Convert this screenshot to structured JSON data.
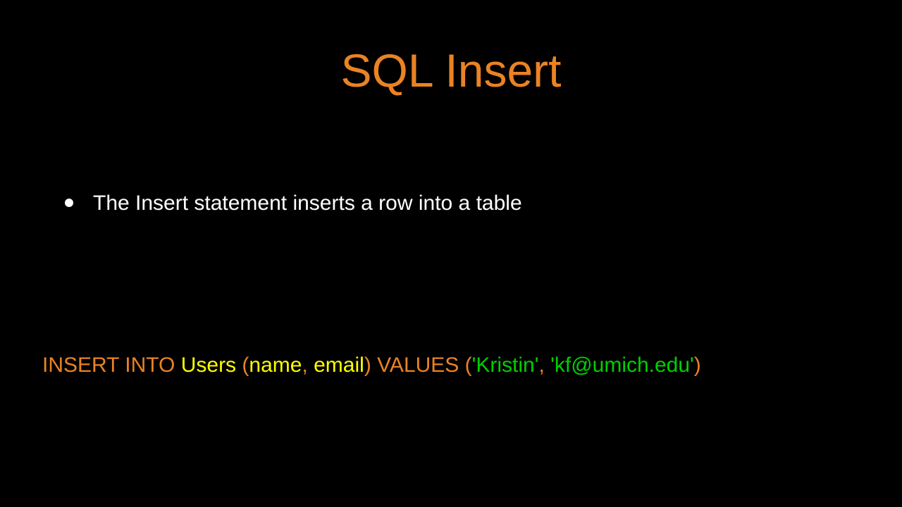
{
  "title": "SQL Insert",
  "bullet": "The Insert statement inserts a row into a table",
  "code": {
    "kw1": "INSERT INTO ",
    "id1": "Users ",
    "kw2": "(",
    "id2": "name",
    "kw3": ", ",
    "id3": "email",
    "kw4": ") VALUES (",
    "lit1": "'Kristin'",
    "kw5": ", ",
    "lit2": "'kf@umich.edu'",
    "kw6": ")"
  }
}
